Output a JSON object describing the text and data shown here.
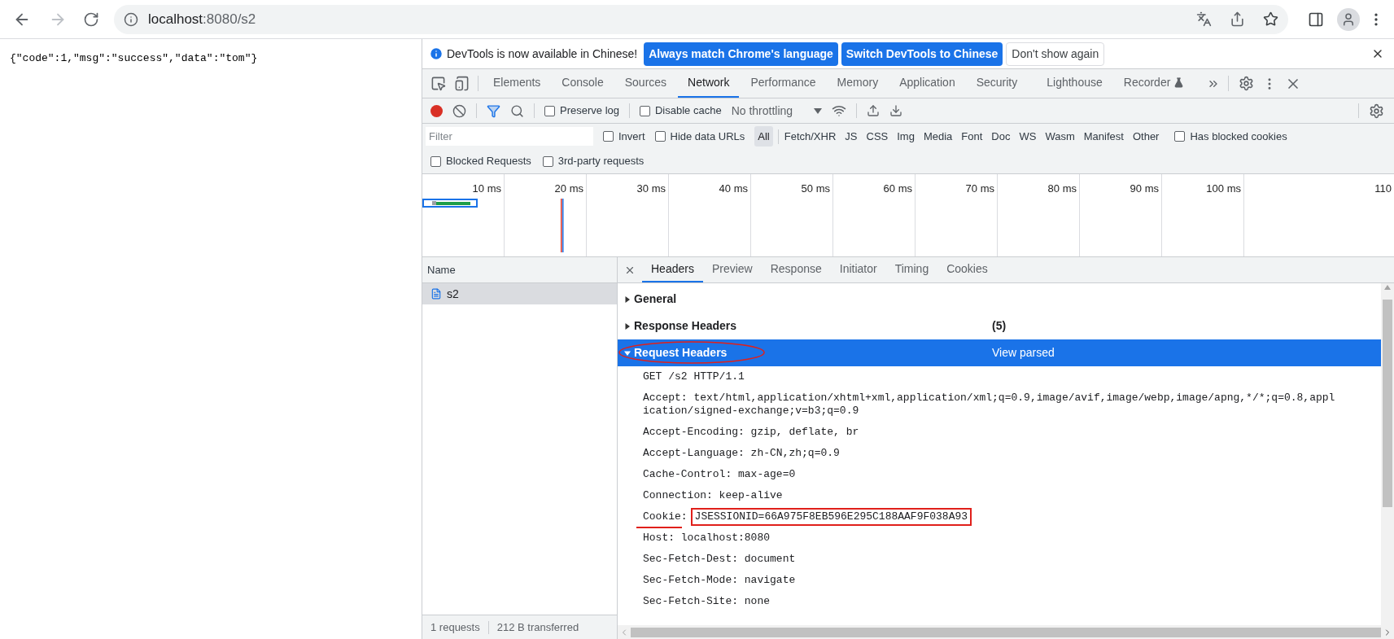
{
  "browser": {
    "url_host": "localhost",
    "url_path": ":8080/s2"
  },
  "page": {
    "body": "{\"code\":1,\"msg\":\"success\",\"data\":\"tom\"}"
  },
  "devtools": {
    "infobar": {
      "message": "DevTools is now available in Chinese!",
      "buttons": [
        {
          "label": "Always match Chrome's language",
          "kind": "primary"
        },
        {
          "label": "Switch DevTools to Chinese",
          "kind": "primary"
        },
        {
          "label": "Don't show again",
          "kind": "secondary"
        }
      ]
    },
    "tabs": [
      {
        "label": "Elements",
        "selected": false,
        "experiment": false
      },
      {
        "label": "Console",
        "selected": false,
        "experiment": false
      },
      {
        "label": "Sources",
        "selected": false,
        "experiment": false
      },
      {
        "label": "Network",
        "selected": true,
        "experiment": false
      },
      {
        "label": "Performance",
        "selected": false,
        "experiment": false
      },
      {
        "label": "Memory",
        "selected": false,
        "experiment": false
      },
      {
        "label": "Application",
        "selected": false,
        "experiment": false
      },
      {
        "label": "Security",
        "selected": false,
        "experiment": false
      },
      {
        "label": "Lighthouse",
        "selected": false,
        "experiment": false
      },
      {
        "label": "Recorder",
        "selected": false,
        "experiment": true
      }
    ],
    "toolbar": {
      "recording": true,
      "filter_active": true,
      "checkboxes": [
        {
          "label": "Preserve log",
          "checked": false
        },
        {
          "label": "Disable cache",
          "checked": false
        }
      ],
      "throttling": "No throttling"
    },
    "filter": {
      "placeholder": "Filter",
      "options": [
        {
          "label": "Invert",
          "checked": false
        },
        {
          "label": "Hide data URLs",
          "checked": false
        }
      ],
      "types": [
        {
          "label": "All",
          "selected": true
        },
        {
          "label": "Fetch/XHR",
          "selected": false
        },
        {
          "label": "JS",
          "selected": false
        },
        {
          "label": "CSS",
          "selected": false
        },
        {
          "label": "Img",
          "selected": false
        },
        {
          "label": "Media",
          "selected": false
        },
        {
          "label": "Font",
          "selected": false
        },
        {
          "label": "Doc",
          "selected": false
        },
        {
          "label": "WS",
          "selected": false
        },
        {
          "label": "Wasm",
          "selected": false
        },
        {
          "label": "Manifest",
          "selected": false
        },
        {
          "label": "Other",
          "selected": false
        }
      ],
      "blocked_cookies": {
        "label": "Has blocked cookies",
        "checked": false
      },
      "more": [
        {
          "label": "Blocked Requests",
          "checked": false
        },
        {
          "label": "3rd-party requests",
          "checked": false
        }
      ]
    },
    "timeline": {
      "ticks": [
        "10 ms",
        "20 ms",
        "30 ms",
        "40 ms",
        "50 ms",
        "60 ms",
        "70 ms",
        "80 ms",
        "90 ms",
        "100 ms",
        "110"
      ]
    },
    "requests": {
      "header": "Name",
      "items": [
        {
          "name": "s2",
          "selected": true
        }
      ]
    },
    "status": [
      "1 requests",
      "212 B transferred"
    ],
    "detail_tabs": [
      {
        "label": "Headers",
        "selected": true
      },
      {
        "label": "Preview",
        "selected": false
      },
      {
        "label": "Response",
        "selected": false
      },
      {
        "label": "Initiator",
        "selected": false
      },
      {
        "label": "Timing",
        "selected": false
      },
      {
        "label": "Cookies",
        "selected": false
      }
    ],
    "sections": [
      {
        "title": "General",
        "expanded": false,
        "selected": false,
        "annotated": false
      },
      {
        "title": "Response Headers",
        "expanded": false,
        "selected": false,
        "annotated": false,
        "count": "(5)"
      },
      {
        "title": "Request Headers",
        "expanded": true,
        "selected": true,
        "annotated": true,
        "action": "View parsed",
        "lines": [
          {
            "name": "GET /s2 HTTP/1.1",
            "annotated": false
          },
          {
            "name": "Accept:",
            "value": "text/html,application/xhtml+xml,application/xml;q=0.9,image/avif,image/webp,image/apng,*/*;q=0.8,application/signed-exchange;v=b3;q=0.9",
            "annotated": false
          },
          {
            "name": "Accept-Encoding:",
            "value": "gzip, deflate, br",
            "annotated": false
          },
          {
            "name": "Accept-Language:",
            "value": "zh-CN,zh;q=0.9",
            "annotated": false
          },
          {
            "name": "Cache-Control:",
            "value": "max-age=0",
            "annotated": false
          },
          {
            "name": "Connection:",
            "value": "keep-alive",
            "annotated": false
          },
          {
            "name": "Cookie:",
            "value": "JSESSIONID=66A975F8EB596E295C188AAF9F038A93",
            "annotated": true
          },
          {
            "name": "Host:",
            "value": "localhost:8080",
            "annotated": false
          },
          {
            "name": "Sec-Fetch-Dest:",
            "value": "document",
            "annotated": false
          },
          {
            "name": "Sec-Fetch-Mode:",
            "value": "navigate",
            "annotated": false
          },
          {
            "name": "Sec-Fetch-Site:",
            "value": "none",
            "annotated": false
          }
        ]
      }
    ]
  }
}
